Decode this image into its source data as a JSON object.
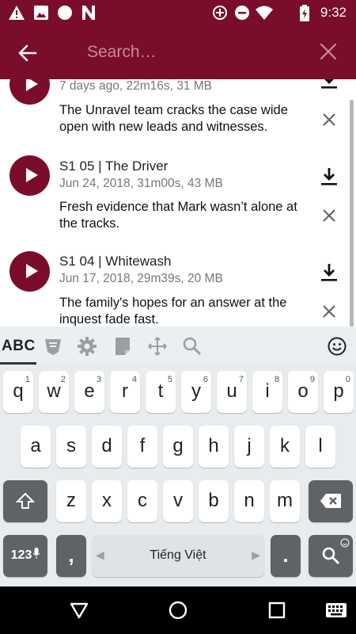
{
  "status_bar": {
    "time": "9:32",
    "icons": [
      "warning-icon",
      "image-icon",
      "circle-icon",
      "n-icon",
      "data-saver-icon",
      "do-not-disturb-icon",
      "wifi-icon",
      "battery-charging-icon"
    ]
  },
  "app_bar": {
    "search_placeholder": "Search…",
    "back_icon": "arrow-left-icon",
    "clear_icon": "close-icon"
  },
  "episodes": [
    {
      "title": "",
      "meta": "7 days ago, 22m16s, 31 MB",
      "description": "The Unravel team cracks the case wide open with new leads and witnesses."
    },
    {
      "title": "S1 05 | The Driver",
      "meta": "Jun 24, 2018, 31m00s, 43 MB",
      "description": "Fresh evidence that Mark wasn’t alone at the tracks."
    },
    {
      "title": "S1 04 | Whitewash",
      "meta": "Jun 17, 2018, 29m39s, 20 MB",
      "description": "The family's hopes for an answer at the inquest fade fast."
    }
  ],
  "keyboard": {
    "mode_label": "ABC",
    "row1": [
      "q",
      "w",
      "e",
      "r",
      "t",
      "y",
      "u",
      "i",
      "o",
      "p"
    ],
    "row1_hints": [
      "1",
      "2",
      "3",
      "4",
      "5",
      "6",
      "7",
      "8",
      "9",
      "0"
    ],
    "row2": [
      "a",
      "s",
      "d",
      "f",
      "g",
      "h",
      "j",
      "k",
      "l"
    ],
    "row3": [
      "z",
      "x",
      "c",
      "v",
      "b",
      "n",
      "m"
    ],
    "symbols_label": "123",
    "comma_label": ",",
    "space_label": "Tiếng Việt",
    "period_label": ".",
    "toolbar_icons": [
      "theme-icon",
      "settings-icon",
      "clipboard-icon",
      "cursor-move-icon",
      "search-icon",
      "emoji-icon"
    ]
  },
  "colors": {
    "primary": "#7a0e2a",
    "placeholder": "#c98a9a",
    "keyboard_background": "#e9ecee",
    "key_background": "#ffffff",
    "dark_key": "#5f6366"
  }
}
